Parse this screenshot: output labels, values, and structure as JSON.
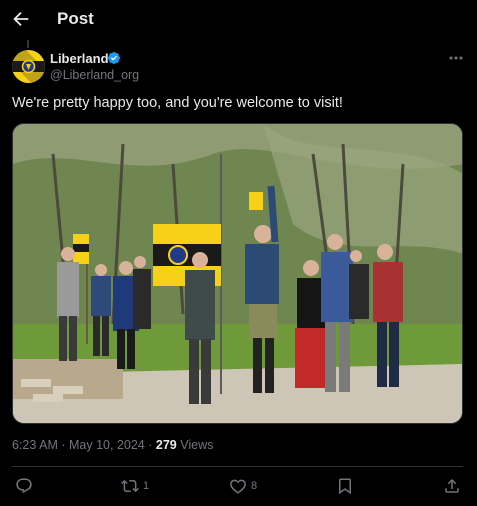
{
  "header": {
    "title": "Post"
  },
  "author": {
    "name": "Liberland",
    "handle": "@Liberland_org"
  },
  "post": {
    "text": "We're pretty happy too, and you're welcome to visit!"
  },
  "meta": {
    "time": "6:23 AM",
    "separator": "·",
    "date": "May 10, 2024",
    "views_count": "279",
    "views_label": "Views"
  },
  "actions": {
    "retweets": "1",
    "likes": "8"
  },
  "colors": {
    "background": "#000000",
    "text": "#e7e9ea",
    "muted": "#71767b",
    "verified": "#1d9bf0",
    "flag_yellow": "#f7d117"
  }
}
